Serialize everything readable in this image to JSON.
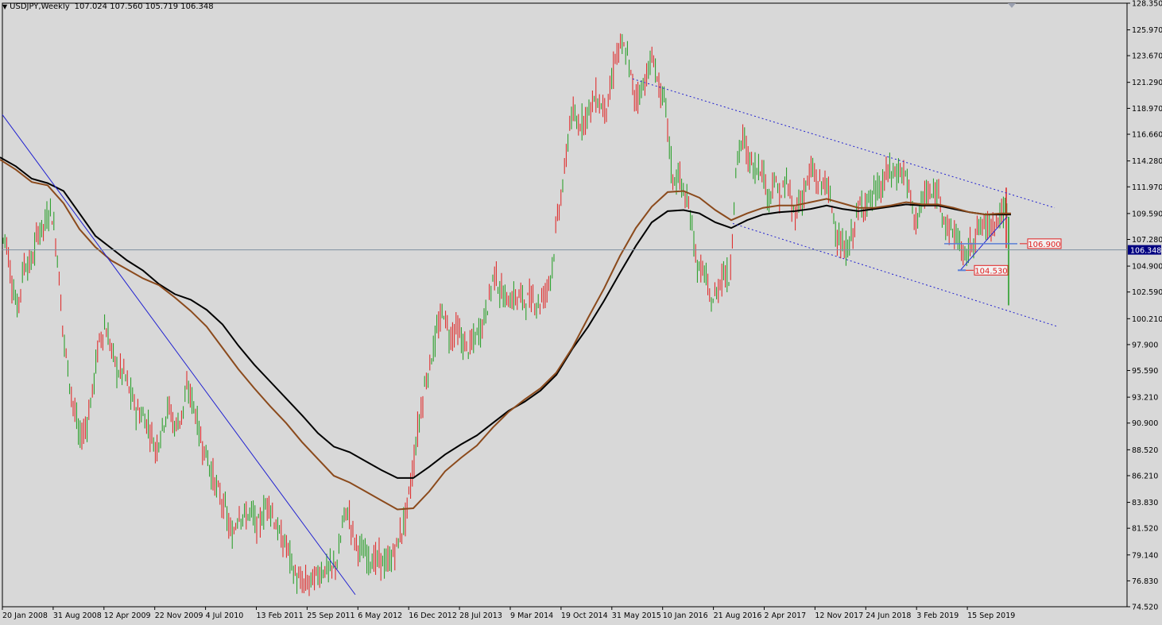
{
  "header": {
    "symbol_timeframe": "USDJPY,Weekly",
    "ohlc": "107.024 107.560 105.719 106.348"
  },
  "colors": {
    "background": "#d8d8d8",
    "bull": "#1e9b1e",
    "bear": "#e02020",
    "ma_fast": "#8b4a1c",
    "ma_slow": "#000000",
    "trendline": "#2020d0",
    "hline": "#5a7fd6",
    "price_label_bg": "#000080",
    "level_label": "#e02020",
    "current_line": "#7f8fa0"
  },
  "chart_data": {
    "type": "candlestick",
    "title": "USDJPY,Weekly",
    "y_ticks": [
      "128.350",
      "125.970",
      "123.670",
      "121.290",
      "118.970",
      "116.660",
      "114.280",
      "111.970",
      "109.590",
      "107.280",
      "104.900",
      "102.590",
      "100.210",
      "97.900",
      "95.590",
      "93.210",
      "90.900",
      "88.520",
      "86.210",
      "83.830",
      "81.520",
      "79.140",
      "76.830",
      "74.520"
    ],
    "ylim": [
      74.52,
      128.35
    ],
    "x_ticks": [
      "20 Jan 2008",
      "31 Aug 2008",
      "12 Apr 2009",
      "22 Nov 2009",
      "4 Jul 2010",
      "13 Feb 2011",
      "25 Sep 2011",
      "6 May 2012",
      "16 Dec 2012",
      "28 Jul 2013",
      "9 Mar 2014",
      "19 Oct 2014",
      "31 May 2015",
      "10 Jan 2016",
      "21 Aug 2016",
      "2 Apr 2017",
      "12 Nov 2017",
      "24 Jun 2018",
      "3 Feb 2019",
      "15 Sep 2019"
    ],
    "last_price": "106.348",
    "level_labels": [
      "106.900",
      "104.530"
    ],
    "price_path": [
      [
        0,
        106.4
      ],
      [
        7,
        107.8
      ],
      [
        14,
        103.8
      ],
      [
        22,
        101.0
      ],
      [
        30,
        105.0
      ],
      [
        40,
        105.2
      ],
      [
        48,
        108.0
      ],
      [
        56,
        108.5
      ],
      [
        64,
        110.2
      ],
      [
        72,
        106.0
      ],
      [
        80,
        98.5
      ],
      [
        90,
        93.5
      ],
      [
        100,
        89.5
      ],
      [
        108,
        90.5
      ],
      [
        116,
        93.5
      ],
      [
        124,
        98.0
      ],
      [
        132,
        99.5
      ],
      [
        140,
        97.5
      ],
      [
        148,
        95.5
      ],
      [
        156,
        95.5
      ],
      [
        164,
        93.5
      ],
      [
        172,
        92.0
      ],
      [
        180,
        91.5
      ],
      [
        188,
        90.5
      ],
      [
        196,
        88.5
      ],
      [
        204,
        90.5
      ],
      [
        212,
        92.5
      ],
      [
        220,
        90.5
      ],
      [
        228,
        91.5
      ],
      [
        236,
        94.0
      ],
      [
        244,
        92.5
      ],
      [
        252,
        89.5
      ],
      [
        260,
        88.0
      ],
      [
        268,
        86.0
      ],
      [
        276,
        84.5
      ],
      [
        284,
        83.0
      ],
      [
        292,
        80.5
      ],
      [
        300,
        83.0
      ],
      [
        308,
        82.5
      ],
      [
        316,
        83.0
      ],
      [
        324,
        81.5
      ],
      [
        332,
        83.0
      ],
      [
        338,
        84.0
      ],
      [
        346,
        82.0
      ],
      [
        354,
        80.5
      ],
      [
        362,
        79.8
      ],
      [
        370,
        77.5
      ],
      [
        378,
        76.6
      ],
      [
        386,
        76.6
      ],
      [
        394,
        77.0
      ],
      [
        402,
        77.5
      ],
      [
        410,
        78.0
      ],
      [
        418,
        77.8
      ],
      [
        426,
        79.0
      ],
      [
        432,
        82.5
      ],
      [
        438,
        83.0
      ],
      [
        446,
        80.5
      ],
      [
        454,
        79.5
      ],
      [
        462,
        79.0
      ],
      [
        470,
        78.6
      ],
      [
        478,
        78.8
      ],
      [
        486,
        78.2
      ],
      [
        494,
        79.0
      ],
      [
        502,
        80.5
      ],
      [
        510,
        82.5
      ],
      [
        518,
        86.0
      ],
      [
        526,
        90.5
      ],
      [
        534,
        94.0
      ],
      [
        542,
        96.5
      ],
      [
        550,
        99.0
      ],
      [
        558,
        101.0
      ],
      [
        566,
        98.5
      ],
      [
        574,
        99.5
      ],
      [
        582,
        98.0
      ],
      [
        590,
        97.5
      ],
      [
        598,
        98.5
      ],
      [
        606,
        99.5
      ],
      [
        614,
        101.5
      ],
      [
        622,
        104.5
      ],
      [
        630,
        102.5
      ],
      [
        638,
        101.8
      ],
      [
        646,
        102.0
      ],
      [
        654,
        102.2
      ],
      [
        662,
        101.8
      ],
      [
        670,
        102.0
      ],
      [
        678,
        101.5
      ],
      [
        686,
        102.5
      ],
      [
        694,
        104.5
      ],
      [
        702,
        109.5
      ],
      [
        710,
        113.0
      ],
      [
        718,
        118.5
      ],
      [
        726,
        117.5
      ],
      [
        734,
        118.0
      ],
      [
        742,
        119.0
      ],
      [
        750,
        120.0
      ],
      [
        758,
        119.0
      ],
      [
        766,
        119.5
      ],
      [
        774,
        123.5
      ],
      [
        782,
        124.5
      ],
      [
        790,
        123.5
      ],
      [
        798,
        120.0
      ],
      [
        806,
        120.5
      ],
      [
        814,
        122.0
      ],
      [
        822,
        123.5
      ],
      [
        830,
        120.5
      ],
      [
        838,
        119.0
      ],
      [
        846,
        112.5
      ],
      [
        854,
        113.0
      ],
      [
        862,
        111.0
      ],
      [
        870,
        109.0
      ],
      [
        878,
        104.5
      ],
      [
        886,
        104.5
      ],
      [
        894,
        101.5
      ],
      [
        902,
        102.5
      ],
      [
        910,
        104.5
      ],
      [
        918,
        103.5
      ],
      [
        926,
        113.5
      ],
      [
        934,
        116.5
      ],
      [
        942,
        114.5
      ],
      [
        950,
        113.5
      ],
      [
        958,
        114.0
      ],
      [
        966,
        111.0
      ],
      [
        974,
        112.5
      ],
      [
        982,
        111.0
      ],
      [
        990,
        112.5
      ],
      [
        998,
        109.5
      ],
      [
        1006,
        110.5
      ],
      [
        1014,
        112.0
      ],
      [
        1022,
        113.5
      ],
      [
        1030,
        112.0
      ],
      [
        1038,
        112.5
      ],
      [
        1046,
        110.5
      ],
      [
        1054,
        107.5
      ],
      [
        1062,
        106.0
      ],
      [
        1070,
        107.0
      ],
      [
        1078,
        109.5
      ],
      [
        1086,
        110.5
      ],
      [
        1094,
        110.8
      ],
      [
        1102,
        111.5
      ],
      [
        1110,
        112.0
      ],
      [
        1118,
        113.5
      ],
      [
        1126,
        113.0
      ],
      [
        1134,
        113.5
      ],
      [
        1142,
        112.5
      ],
      [
        1150,
        109.0
      ],
      [
        1158,
        110.0
      ],
      [
        1166,
        111.5
      ],
      [
        1174,
        111.0
      ],
      [
        1182,
        111.5
      ],
      [
        1190,
        108.5
      ],
      [
        1198,
        108.0
      ],
      [
        1206,
        107.5
      ],
      [
        1212,
        105.5
      ],
      [
        1220,
        106.5
      ],
      [
        1228,
        108.0
      ],
      [
        1236,
        108.5
      ],
      [
        1244,
        108.5
      ],
      [
        1252,
        109.0
      ],
      [
        1260,
        109.5
      ],
      [
        1266,
        110.0
      ],
      [
        1270,
        106.4
      ]
    ],
    "ma_fast_path": [
      [
        0,
        114.4
      ],
      [
        20,
        113.5
      ],
      [
        40,
        112.4
      ],
      [
        60,
        112.1
      ],
      [
        80,
        110.5
      ],
      [
        100,
        108.2
      ],
      [
        120,
        106.6
      ],
      [
        140,
        105.4
      ],
      [
        160,
        104.6
      ],
      [
        180,
        103.8
      ],
      [
        200,
        103.2
      ],
      [
        220,
        102.1
      ],
      [
        240,
        100.9
      ],
      [
        260,
        99.5
      ],
      [
        280,
        97.6
      ],
      [
        300,
        95.7
      ],
      [
        320,
        94.0
      ],
      [
        340,
        92.4
      ],
      [
        360,
        90.9
      ],
      [
        380,
        89.2
      ],
      [
        400,
        87.7
      ],
      [
        420,
        86.2
      ],
      [
        440,
        85.6
      ],
      [
        460,
        84.8
      ],
      [
        480,
        84.0
      ],
      [
        500,
        83.2
      ],
      [
        520,
        83.3
      ],
      [
        540,
        84.8
      ],
      [
        560,
        86.6
      ],
      [
        580,
        87.8
      ],
      [
        600,
        88.9
      ],
      [
        620,
        90.5
      ],
      [
        640,
        91.9
      ],
      [
        660,
        93.0
      ],
      [
        680,
        94.0
      ],
      [
        700,
        95.4
      ],
      [
        720,
        97.6
      ],
      [
        740,
        100.3
      ],
      [
        760,
        102.9
      ],
      [
        780,
        105.8
      ],
      [
        800,
        108.3
      ],
      [
        820,
        110.2
      ],
      [
        840,
        111.5
      ],
      [
        860,
        111.6
      ],
      [
        880,
        111.0
      ],
      [
        900,
        109.9
      ],
      [
        920,
        109.0
      ],
      [
        940,
        109.6
      ],
      [
        960,
        110.1
      ],
      [
        980,
        110.3
      ],
      [
        1000,
        110.3
      ],
      [
        1020,
        110.6
      ],
      [
        1040,
        110.9
      ],
      [
        1060,
        110.5
      ],
      [
        1080,
        110.1
      ],
      [
        1100,
        110.1
      ],
      [
        1120,
        110.3
      ],
      [
        1140,
        110.6
      ],
      [
        1160,
        110.4
      ],
      [
        1180,
        110.4
      ],
      [
        1200,
        110.1
      ],
      [
        1220,
        109.7
      ],
      [
        1240,
        109.5
      ],
      [
        1260,
        109.6
      ],
      [
        1272,
        109.6
      ]
    ],
    "ma_slow_path": [
      [
        0,
        114.6
      ],
      [
        20,
        113.8
      ],
      [
        40,
        112.7
      ],
      [
        60,
        112.3
      ],
      [
        80,
        111.6
      ],
      [
        100,
        109.6
      ],
      [
        120,
        107.6
      ],
      [
        140,
        106.5
      ],
      [
        160,
        105.4
      ],
      [
        180,
        104.5
      ],
      [
        200,
        103.3
      ],
      [
        220,
        102.4
      ],
      [
        240,
        101.9
      ],
      [
        260,
        101.0
      ],
      [
        280,
        99.7
      ],
      [
        300,
        97.8
      ],
      [
        320,
        96.1
      ],
      [
        340,
        94.6
      ],
      [
        360,
        93.1
      ],
      [
        380,
        91.6
      ],
      [
        400,
        90.0
      ],
      [
        420,
        88.8
      ],
      [
        440,
        88.3
      ],
      [
        460,
        87.5
      ],
      [
        480,
        86.7
      ],
      [
        500,
        86.0
      ],
      [
        520,
        86.0
      ],
      [
        540,
        87.0
      ],
      [
        560,
        88.1
      ],
      [
        580,
        89.0
      ],
      [
        600,
        89.8
      ],
      [
        620,
        90.9
      ],
      [
        640,
        92.0
      ],
      [
        660,
        92.8
      ],
      [
        680,
        93.8
      ],
      [
        700,
        95.2
      ],
      [
        720,
        97.5
      ],
      [
        740,
        99.5
      ],
      [
        760,
        101.8
      ],
      [
        780,
        104.3
      ],
      [
        800,
        106.7
      ],
      [
        820,
        108.8
      ],
      [
        840,
        109.8
      ],
      [
        860,
        109.9
      ],
      [
        880,
        109.6
      ],
      [
        900,
        108.8
      ],
      [
        920,
        108.3
      ],
      [
        940,
        109.0
      ],
      [
        960,
        109.5
      ],
      [
        980,
        109.7
      ],
      [
        1000,
        109.8
      ],
      [
        1020,
        110.0
      ],
      [
        1040,
        110.3
      ],
      [
        1060,
        110.0
      ],
      [
        1080,
        109.8
      ],
      [
        1100,
        110.0
      ],
      [
        1120,
        110.2
      ],
      [
        1140,
        110.4
      ],
      [
        1160,
        110.3
      ],
      [
        1180,
        110.3
      ],
      [
        1200,
        110.0
      ],
      [
        1220,
        109.7
      ],
      [
        1240,
        109.5
      ],
      [
        1260,
        109.5
      ],
      [
        1272,
        109.5
      ]
    ]
  }
}
